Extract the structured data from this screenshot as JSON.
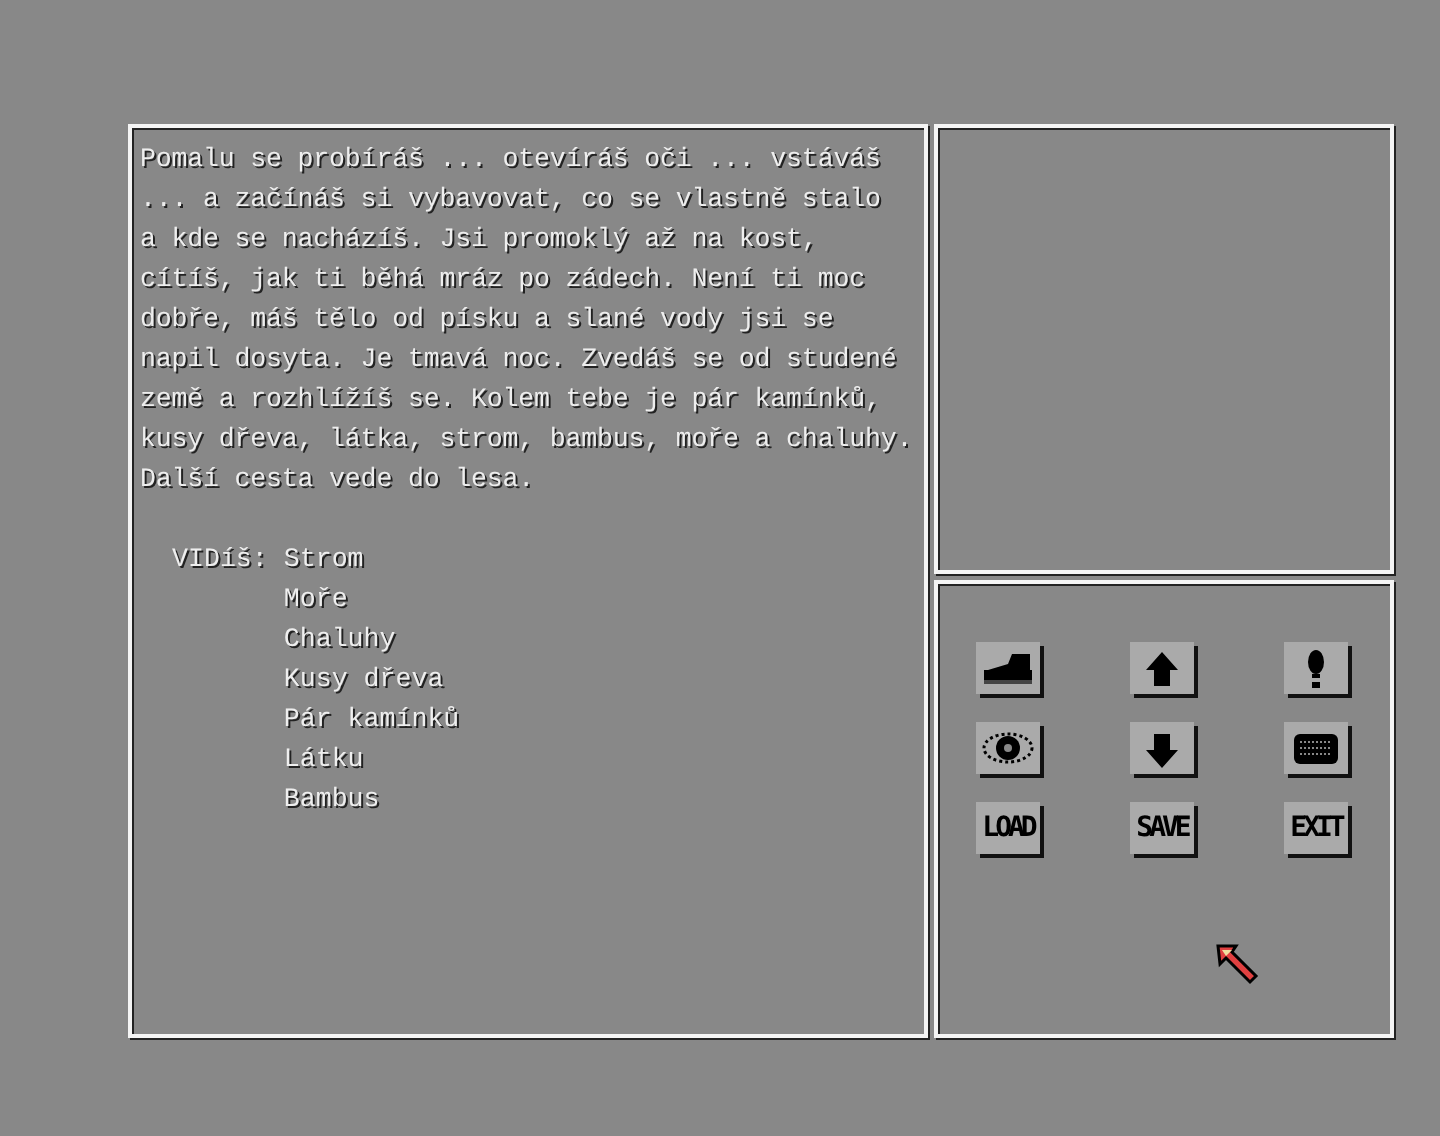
{
  "story": {
    "lines": [
      "Pomalu se probíráš ... otevíráš oči ... vstáváš",
      "... a začínáš si vybavovat, co se vlastně stalo",
      "a kde se nacházíš. Jsi promoklý až na kost,",
      "cítíš, jak ti běhá mráz po zádech. Není ti moc",
      "dobře, máš tělo od písku a slané vody jsi se",
      "napil dosyta. Je tmavá noc. Zvedáš se od studené",
      "země a rozhlížíš se. Kolem tebe je pár kamínků,",
      "kusy dřeva, látka, strom, bambus, moře a chaluhy.",
      "Další cesta vede do lesa."
    ]
  },
  "visible": {
    "label": "VIDíš:",
    "items": [
      "Strom",
      "Moře",
      "Chaluhy",
      "Kusy dřeva",
      "Pár kamínků",
      "Látku",
      "Bambus"
    ]
  },
  "controls": [
    {
      "kind": "icon"
    },
    {
      "kind": "icon"
    },
    {
      "kind": "icon"
    },
    {
      "kind": "icon"
    },
    {
      "kind": "icon"
    },
    {
      "kind": "icon"
    },
    {
      "kind": "text",
      "label": "LOAD"
    },
    {
      "kind": "text",
      "label": "SAVE"
    },
    {
      "kind": "text",
      "label": "EXIT"
    }
  ]
}
